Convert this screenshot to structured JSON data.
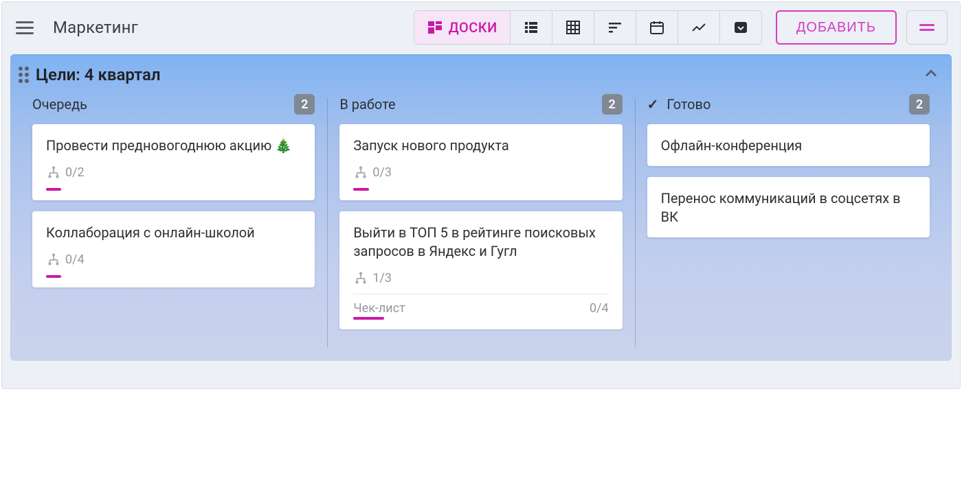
{
  "header": {
    "title": "Маркетинг",
    "boards_tab_label": "ДОСКИ",
    "add_button": "ДОБАВИТЬ"
  },
  "board": {
    "title": "Цели: 4 квартал"
  },
  "columns": [
    {
      "name": "Очередь",
      "count": "2",
      "has_check": false,
      "cards": [
        {
          "title": "Провести предновогоднюю акцию 🎄",
          "subtasks": "0/2",
          "progress_pct": 6,
          "checklist": null
        },
        {
          "title": "Коллаборация с онлайн-школой",
          "subtasks": "0/4",
          "progress_pct": 6,
          "checklist": null
        }
      ]
    },
    {
      "name": "В работе",
      "count": "2",
      "has_check": false,
      "cards": [
        {
          "title": "Запуск нового продукта",
          "subtasks": "0/3",
          "progress_pct": 6,
          "checklist": null
        },
        {
          "title": "Выйти в ТОП 5 в рейтинге поисковых запросов в Яндекс и Гугл",
          "subtasks": "1/3",
          "progress_pct": 12,
          "checklist": {
            "label": "Чек-лист",
            "count": "0/4"
          }
        }
      ]
    },
    {
      "name": "Готово",
      "count": "2",
      "has_check": true,
      "cards": [
        {
          "title": "Офлайн-конференция",
          "subtasks": null,
          "progress_pct": null,
          "checklist": null
        },
        {
          "title": "Перенос коммуникаций в соцсетях в ВК",
          "subtasks": null,
          "progress_pct": null,
          "checklist": null
        }
      ]
    }
  ]
}
